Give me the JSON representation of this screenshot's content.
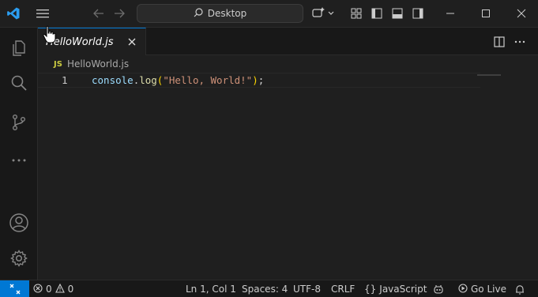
{
  "titlebar": {
    "search_text": "Desktop"
  },
  "tabs": [
    {
      "label": "HelloWorld.js"
    }
  ],
  "breadcrumb": {
    "file_badge": "JS",
    "file_name": "HelloWorld.js"
  },
  "editor": {
    "line_number": "1",
    "tokens": {
      "object": "console",
      "dot": ".",
      "method": "log",
      "open_paren": "(",
      "string": "\"Hello, World!\"",
      "close_paren": ")",
      "semicolon": ";"
    }
  },
  "statusbar": {
    "errors": "0",
    "warnings": "0",
    "position": "Ln 1, Col 1",
    "spaces": "Spaces: 4",
    "encoding": "UTF-8",
    "eol": "CRLF",
    "language_braces": "{}",
    "language": "JavaScript",
    "golive": "Go Live"
  },
  "colors": {
    "accent": "#0078d4",
    "background": "#1f1f1f",
    "activity_bar": "#181818"
  }
}
